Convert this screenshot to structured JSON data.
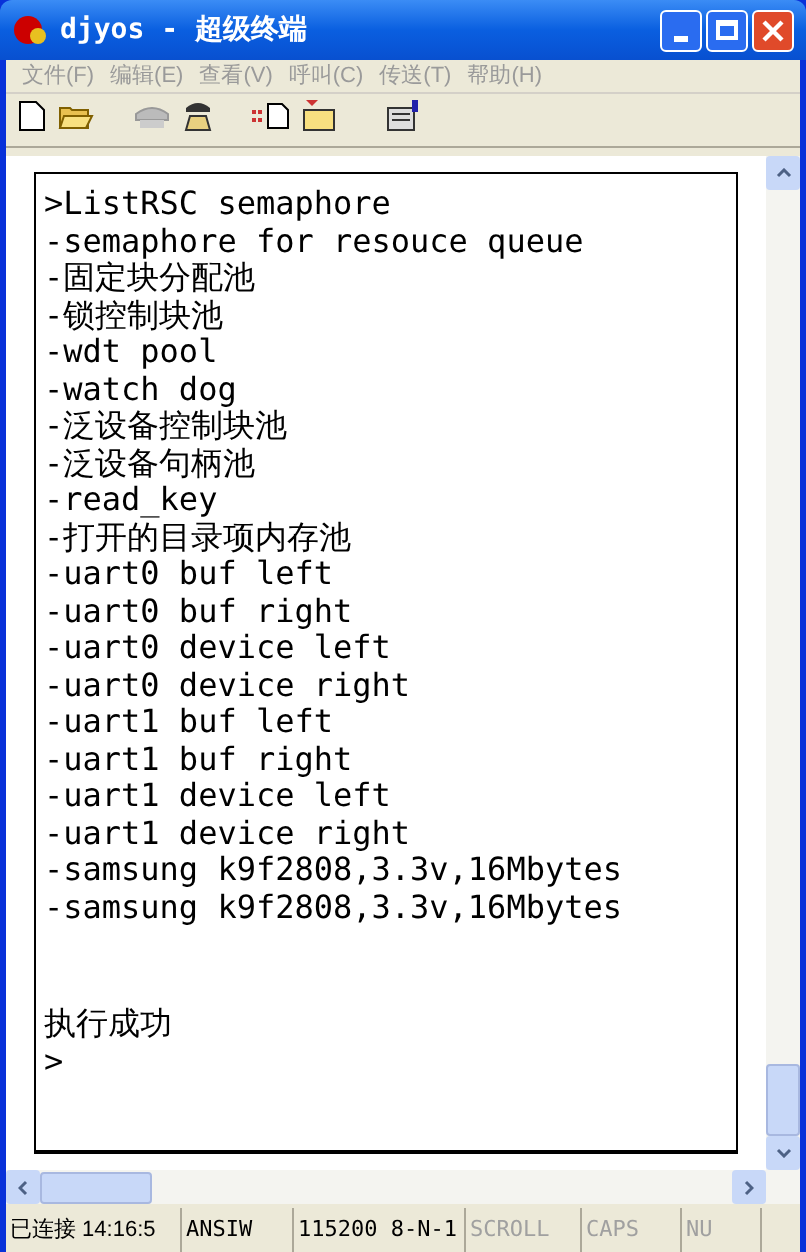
{
  "window": {
    "title": "djyos - 超级终端"
  },
  "menu": [
    "文件(F)",
    "编辑(E)",
    "查看(V)",
    "呼叫(C)",
    "传送(T)",
    "帮助(H)"
  ],
  "terminal": {
    "lines": [
      ">ListRSC semaphore",
      "-semaphore for resouce queue",
      "-固定块分配池",
      "-锁控制块池",
      "-wdt pool",
      "-watch dog",
      "-泛设备控制块池",
      "-泛设备句柄池",
      "-read_key",
      "-打开的目录项内存池",
      "-uart0 buf left",
      "-uart0 buf right",
      "-uart0 device left",
      "-uart0 device right",
      "-uart1 buf left",
      "-uart1 buf right",
      "-uart1 device left",
      "-uart1 device right",
      "-samsung k9f2808,3.3v,16Mbytes",
      "-samsung k9f2808,3.3v,16Mbytes"
    ],
    "footer_lines": [
      "执行成功",
      ">"
    ]
  },
  "status_bar": [
    {
      "text": "已连接 14:16:5",
      "active": true
    },
    {
      "text": "ANSIW",
      "active": true
    },
    {
      "text": "115200 8-N-1",
      "active": true
    },
    {
      "text": "SCROLL",
      "active": false
    },
    {
      "text": "CAPS",
      "active": false
    },
    {
      "text": "NU",
      "active": false
    }
  ]
}
